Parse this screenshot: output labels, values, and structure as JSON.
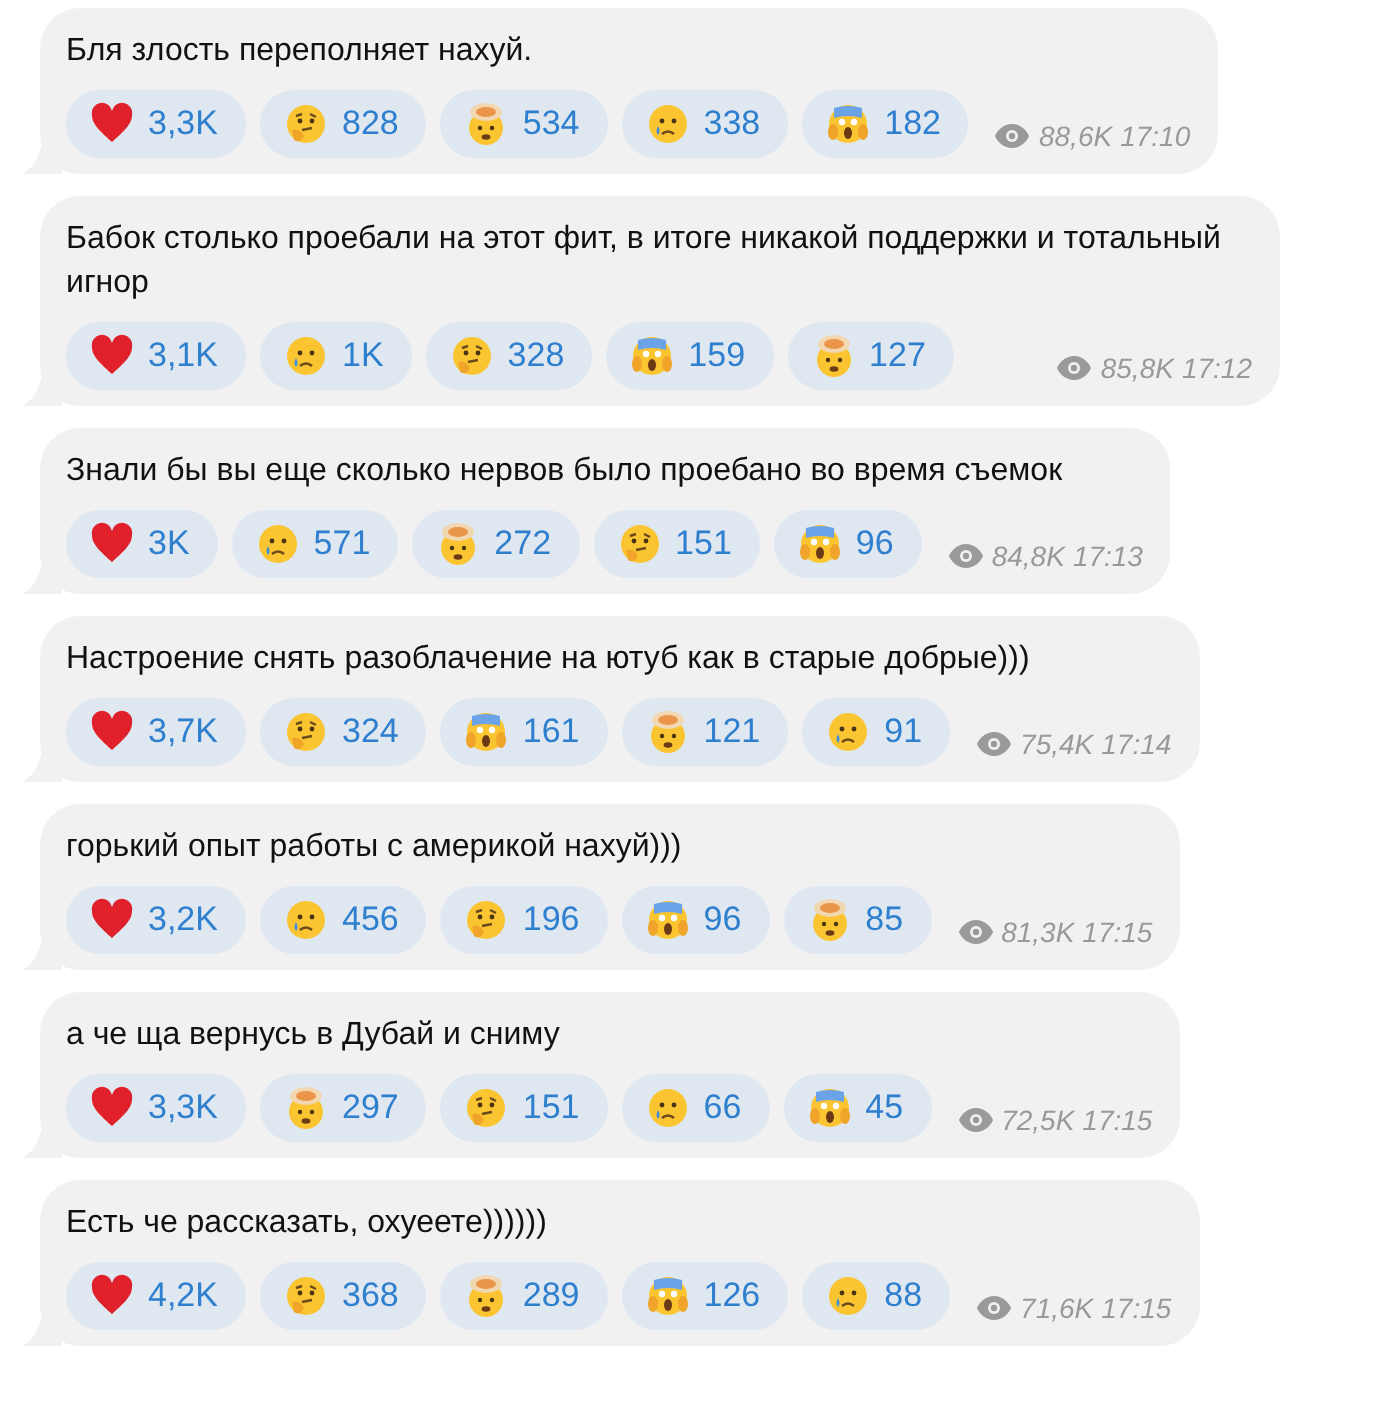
{
  "messages": [
    {
      "text": "Бля злость переполняет нахуй.",
      "reactions": [
        {
          "kind": "heart",
          "count": "3,3K"
        },
        {
          "kind": "thinking",
          "count": "828"
        },
        {
          "kind": "exploding",
          "count": "534"
        },
        {
          "kind": "crying",
          "count": "338"
        },
        {
          "kind": "scream",
          "count": "182"
        }
      ],
      "views": "88,6K",
      "time": "17:10"
    },
    {
      "text": "Бабок столько проебали на этот фит, в итоге никакой поддержки и тотальный игнор",
      "reactions": [
        {
          "kind": "heart",
          "count": "3,1K"
        },
        {
          "kind": "crying",
          "count": "1K"
        },
        {
          "kind": "thinking",
          "count": "328"
        },
        {
          "kind": "scream",
          "count": "159"
        },
        {
          "kind": "exploding",
          "count": "127"
        }
      ],
      "views": "85,8K",
      "time": "17:12"
    },
    {
      "text": "Знали бы вы еще сколько нервов было проебано во время съемок",
      "reactions": [
        {
          "kind": "heart",
          "count": "3K"
        },
        {
          "kind": "crying",
          "count": "571"
        },
        {
          "kind": "exploding",
          "count": "272"
        },
        {
          "kind": "thinking",
          "count": "151"
        },
        {
          "kind": "scream",
          "count": "96"
        }
      ],
      "views": "84,8K",
      "time": "17:13"
    },
    {
      "text": "Настроение снять разоблачение на ютуб как в старые добрые)))",
      "reactions": [
        {
          "kind": "heart",
          "count": "3,7K"
        },
        {
          "kind": "thinking",
          "count": "324"
        },
        {
          "kind": "scream",
          "count": "161"
        },
        {
          "kind": "exploding",
          "count": "121"
        },
        {
          "kind": "crying",
          "count": "91"
        }
      ],
      "views": "75,4K",
      "time": "17:14"
    },
    {
      "text": "горький опыт работы с америкой нахуй)))",
      "reactions": [
        {
          "kind": "heart",
          "count": "3,2K"
        },
        {
          "kind": "crying",
          "count": "456"
        },
        {
          "kind": "thinking",
          "count": "196"
        },
        {
          "kind": "scream",
          "count": "96"
        },
        {
          "kind": "exploding",
          "count": "85"
        }
      ],
      "views": "81,3K",
      "time": "17:15"
    },
    {
      "text": "а че ща вернусь в Дубай и сниму",
      "reactions": [
        {
          "kind": "heart",
          "count": "3,3K"
        },
        {
          "kind": "exploding",
          "count": "297"
        },
        {
          "kind": "thinking",
          "count": "151"
        },
        {
          "kind": "crying",
          "count": "66"
        },
        {
          "kind": "scream",
          "count": "45"
        }
      ],
      "views": "72,5K",
      "time": "17:15"
    },
    {
      "text": "Есть че рассказать, охуеете))))))",
      "reactions": [
        {
          "kind": "heart",
          "count": "4,2K"
        },
        {
          "kind": "thinking",
          "count": "368"
        },
        {
          "kind": "exploding",
          "count": "289"
        },
        {
          "kind": "scream",
          "count": "126"
        },
        {
          "kind": "crying",
          "count": "88"
        }
      ],
      "views": "71,6K",
      "time": "17:15"
    }
  ]
}
